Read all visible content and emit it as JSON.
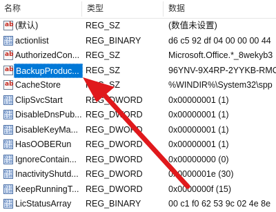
{
  "columns": {
    "name": "名称",
    "type": "类型",
    "data": "数据"
  },
  "rows": [
    {
      "icon": "string-value-icon",
      "name": "(默认)",
      "type": "REG_SZ",
      "data": "(数值未设置)"
    },
    {
      "icon": "binary-value-icon",
      "name": "actionlist",
      "type": "REG_BINARY",
      "data": "d6 c5 92 df 04 00 00 00 44"
    },
    {
      "icon": "string-value-icon",
      "name": "AuthorizedCon...",
      "type": "REG_SZ",
      "data": "Microsoft.Office.*_8wekyb3"
    },
    {
      "icon": "string-value-icon",
      "name": "BackupProduc...",
      "type": "REG_SZ",
      "data": "96YNV-9X4RP-2YYKB-RMC",
      "selected": true
    },
    {
      "icon": "string-value-icon",
      "name": "CacheStore",
      "type": "REG_SZ",
      "data": "%WINDIR%\\System32\\spp"
    },
    {
      "icon": "binary-value-icon",
      "name": "ClipSvcStart",
      "type": "REG_DWORD",
      "data": "0x00000001 (1)"
    },
    {
      "icon": "binary-value-icon",
      "name": "DisableDnsPub...",
      "type": "REG_DWORD",
      "data": "0x00000001 (1)"
    },
    {
      "icon": "binary-value-icon",
      "name": "DisableKeyMa...",
      "type": "REG_DWORD",
      "data": "0x00000001 (1)"
    },
    {
      "icon": "binary-value-icon",
      "name": "HasOOBERun",
      "type": "REG_DWORD",
      "data": "0x00000001 (1)"
    },
    {
      "icon": "binary-value-icon",
      "name": "IgnoreContain...",
      "type": "REG_DWORD",
      "data": "0x00000000 (0)"
    },
    {
      "icon": "binary-value-icon",
      "name": "InactivityShutd...",
      "type": "REG_DWORD",
      "data": "0x0000001e (30)"
    },
    {
      "icon": "binary-value-icon",
      "name": "KeepRunningT...",
      "type": "REG_DWORD",
      "data": "0x0000000f (15)"
    },
    {
      "icon": "binary-value-icon",
      "name": "LicStatusArray",
      "type": "REG_BINARY",
      "data": "00 c1 f0 62 53 9c 02 4e 8e"
    }
  ],
  "colors": {
    "selection": "#0078d7",
    "arrow": "#e0191c"
  }
}
